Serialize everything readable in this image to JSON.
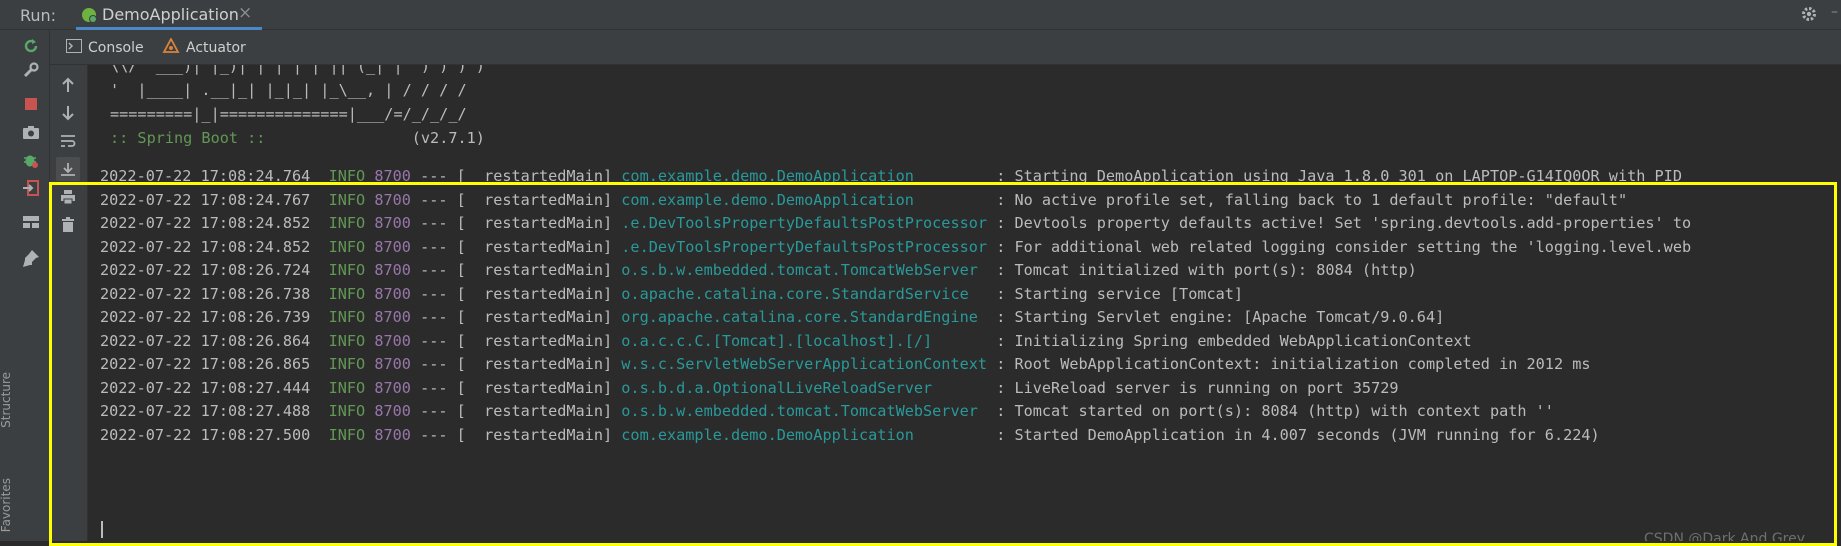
{
  "run_bar": {
    "label": "Run:",
    "tab_title": "DemoApplication",
    "tab_close": "×"
  },
  "subtabs": {
    "console": "Console",
    "actuator": "Actuator"
  },
  "banner": {
    "line1": "\\\\/  ___)| |_)| | | | | || (_| |  ) ) ) )",
    "line2": "'  |____| .__|_| |_|_| |_\\__, | / / / /",
    "line3": "=========|_|==============|___/=/_/_/_/",
    "spring_prefix": ":: Spring Boot ::",
    "spring_version": "(v2.7.1)"
  },
  "log_lines": [
    {
      "ts": "2022-07-22 17:08:24.764",
      "level": "INFO",
      "pid": "8700",
      "thread": "[  restartedMain]",
      "logger": "com.example.demo.DemoApplication        ",
      "msg": ": Starting DemoApplication using Java 1.8.0_301 on LAPTOP-G14IQ0OR with PID"
    },
    {
      "ts": "2022-07-22 17:08:24.767",
      "level": "INFO",
      "pid": "8700",
      "thread": "[  restartedMain]",
      "logger": "com.example.demo.DemoApplication        ",
      "msg": ": No active profile set, falling back to 1 default profile: \"default\""
    },
    {
      "ts": "2022-07-22 17:08:24.852",
      "level": "INFO",
      "pid": "8700",
      "thread": "[  restartedMain]",
      "logger": ".e.DevToolsPropertyDefaultsPostProcessor",
      "msg": ": Devtools property defaults active! Set 'spring.devtools.add-properties' to"
    },
    {
      "ts": "2022-07-22 17:08:24.852",
      "level": "INFO",
      "pid": "8700",
      "thread": "[  restartedMain]",
      "logger": ".e.DevToolsPropertyDefaultsPostProcessor",
      "msg": ": For additional web related logging consider setting the 'logging.level.web"
    },
    {
      "ts": "2022-07-22 17:08:26.724",
      "level": "INFO",
      "pid": "8700",
      "thread": "[  restartedMain]",
      "logger": "o.s.b.w.embedded.tomcat.TomcatWebServer ",
      "msg": ": Tomcat initialized with port(s): 8084 (http)"
    },
    {
      "ts": "2022-07-22 17:08:26.738",
      "level": "INFO",
      "pid": "8700",
      "thread": "[  restartedMain]",
      "logger": "o.apache.catalina.core.StandardService  ",
      "msg": ": Starting service [Tomcat]"
    },
    {
      "ts": "2022-07-22 17:08:26.739",
      "level": "INFO",
      "pid": "8700",
      "thread": "[  restartedMain]",
      "logger": "org.apache.catalina.core.StandardEngine ",
      "msg": ": Starting Servlet engine: [Apache Tomcat/9.0.64]"
    },
    {
      "ts": "2022-07-22 17:08:26.864",
      "level": "INFO",
      "pid": "8700",
      "thread": "[  restartedMain]",
      "logger": "o.a.c.c.C.[Tomcat].[localhost].[/]      ",
      "msg": ": Initializing Spring embedded WebApplicationContext"
    },
    {
      "ts": "2022-07-22 17:08:26.865",
      "level": "INFO",
      "pid": "8700",
      "thread": "[  restartedMain]",
      "logger": "w.s.c.ServletWebServerApplicationContext",
      "msg": ": Root WebApplicationContext: initialization completed in 2012 ms"
    },
    {
      "ts": "2022-07-22 17:08:27.444",
      "level": "INFO",
      "pid": "8700",
      "thread": "[  restartedMain]",
      "logger": "o.s.b.d.a.OptionalLiveReloadServer      ",
      "msg": ": LiveReload server is running on port 35729"
    },
    {
      "ts": "2022-07-22 17:08:27.488",
      "level": "INFO",
      "pid": "8700",
      "thread": "[  restartedMain]",
      "logger": "o.s.b.w.embedded.tomcat.TomcatWebServer ",
      "msg": ": Tomcat started on port(s): 8084 (http) with context path ''"
    },
    {
      "ts": "2022-07-22 17:08:27.500",
      "level": "INFO",
      "pid": "8700",
      "thread": "[  restartedMain]",
      "logger": "com.example.demo.DemoApplication        ",
      "msg": ": Started DemoApplication in 4.007 seconds (JVM running for 6.224)"
    }
  ],
  "log_separator": "---",
  "side_labels": {
    "structure": "Structure",
    "favorites": "Favorites"
  },
  "watermark": "CSDN @Dark And Grey",
  "colors": {
    "highlight": "#ffff00",
    "logger": "#299999",
    "info": "#629755",
    "pid": "#9876aa",
    "tab_underline": "#4a88c7"
  },
  "icons": {
    "rerun": "rerun-icon",
    "settings": "wrench-icon",
    "stop": "stop-icon",
    "screenshot": "camera-icon",
    "debug": "bug-icon",
    "exit": "exit-icon",
    "layout": "layout-icon",
    "pin": "pin-icon",
    "up": "arrow-up-icon",
    "down": "arrow-down-icon",
    "soft_wrap": "soft-wrap-icon",
    "scroll_end": "scroll-to-end-icon",
    "print": "print-icon",
    "clear": "trash-icon"
  }
}
